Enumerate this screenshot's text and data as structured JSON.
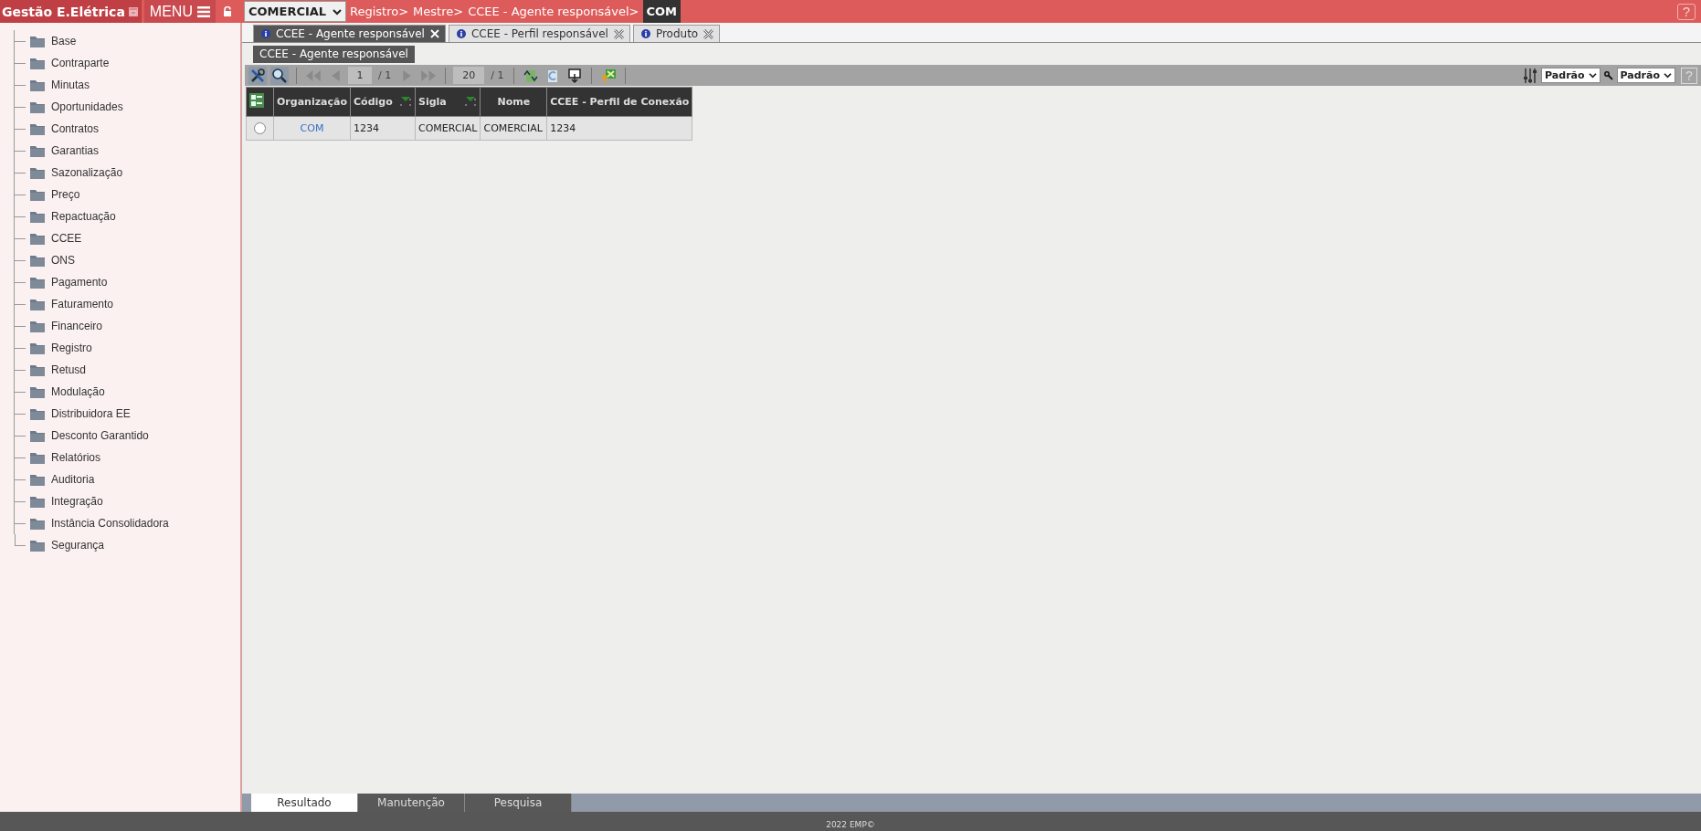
{
  "header": {
    "app_title": "Gestão E.Elétrica",
    "menu_label": "MENU",
    "company": "COMERCIAL",
    "breadcrumb": [
      "Registro>",
      "Mestre>",
      "CCEE - Agente responsável>"
    ],
    "breadcrumb_current": "COM",
    "help": "?"
  },
  "sidebar": {
    "items": [
      {
        "label": "Base"
      },
      {
        "label": "Contraparte"
      },
      {
        "label": "Minutas"
      },
      {
        "label": "Oportunidades"
      },
      {
        "label": "Contratos"
      },
      {
        "label": "Garantias"
      },
      {
        "label": "Sazonalização"
      },
      {
        "label": "Preço"
      },
      {
        "label": "Repactuação"
      },
      {
        "label": "CCEE"
      },
      {
        "label": "ONS"
      },
      {
        "label": "Pagamento"
      },
      {
        "label": "Faturamento"
      },
      {
        "label": "Financeiro"
      },
      {
        "label": "Registro"
      },
      {
        "label": "Retusd"
      },
      {
        "label": "Modulação"
      },
      {
        "label": "Distribuidora EE"
      },
      {
        "label": "Desconto Garantido"
      },
      {
        "label": "Relatórios"
      },
      {
        "label": "Auditoria"
      },
      {
        "label": "Integração"
      },
      {
        "label": "Instância Consolidadora"
      },
      {
        "label": "Segurança"
      }
    ]
  },
  "tabs": [
    {
      "label": "CCEE - Agente responsável",
      "selected": true
    },
    {
      "label": "CCEE - Perfil responsável",
      "selected": false
    },
    {
      "label": "Produto",
      "selected": false
    }
  ],
  "section_title": "CCEE - Agente responsável",
  "toolbar": {
    "page": "1",
    "page_total": "/ 1",
    "page_size": "20",
    "size_total": "/ 1",
    "layout_select": "Padrão",
    "filter_select": "Padrão",
    "help": "?"
  },
  "table": {
    "columns": [
      {
        "label": "Organização",
        "sortable": false,
        "kind": "link"
      },
      {
        "label": "Código",
        "sortable": true,
        "kind": "text"
      },
      {
        "label": "Sigla",
        "sortable": true,
        "kind": "text"
      },
      {
        "label": "Nome",
        "sortable": false,
        "kind": "text"
      },
      {
        "label": "CCEE - Perfil de Conexão",
        "sortable": false,
        "kind": "text"
      }
    ],
    "rows": [
      {
        "selected": false,
        "cells": [
          "COM",
          "1234",
          "COMERCIAL",
          "COMERCIAL",
          "1234"
        ]
      }
    ]
  },
  "bottom_tabs": [
    {
      "label": "Resultado",
      "selected": true
    },
    {
      "label": "Manutenção",
      "selected": false
    },
    {
      "label": "Pesquisa",
      "selected": false
    }
  ],
  "footer": "2022 EMP©"
}
